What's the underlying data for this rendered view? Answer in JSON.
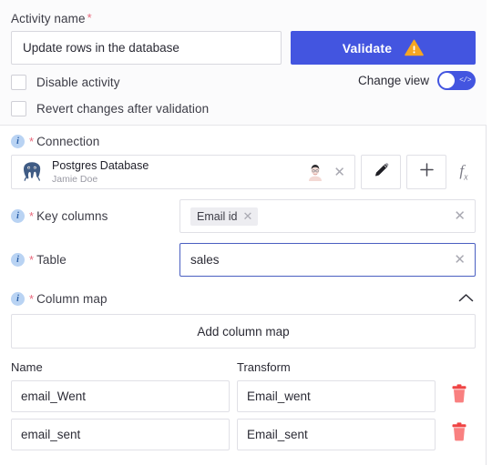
{
  "header": {
    "activity_name_label": "Activity name",
    "required_marker": "*",
    "activity_name_value": "Update rows in the database",
    "validate_label": "Validate",
    "validate_icon": "warning-triangle-icon",
    "validate_color": "#4355e0",
    "warning_color": "#f5a623",
    "change_view_label": "Change view",
    "toggle_icon": "code-icon",
    "toggle_glyph": "</>",
    "checkboxes": [
      {
        "label": "Disable activity",
        "checked": false
      },
      {
        "label": "Revert changes after validation",
        "checked": false
      }
    ]
  },
  "connection": {
    "label": "Connection",
    "info_icon": "info-icon",
    "required_marker": "*",
    "name": "Postgres Database",
    "owner": "Jamie Doe",
    "logo_icon": "postgres-elephant-icon",
    "avatar_icon": "user-avatar-icon",
    "clear_icon": "close-icon",
    "edit_icon": "pencil-icon",
    "add_icon": "plus-icon",
    "fx_icon": "fx-icon",
    "fx_glyph": "f",
    "fx_sub": "x"
  },
  "key_columns": {
    "label": "Key columns",
    "info_icon": "info-icon",
    "required_marker": "*",
    "chips": [
      {
        "label": "Email id",
        "remove_icon": "close-icon"
      }
    ],
    "clear_icon": "close-icon"
  },
  "table_field": {
    "label": "Table",
    "info_icon": "info-icon",
    "required_marker": "*",
    "value": "sales",
    "clear_icon": "close-icon",
    "focused": true,
    "focus_color": "#4a5fc1"
  },
  "column_map": {
    "label": "Column map",
    "info_icon": "info-icon",
    "required_marker": "*",
    "collapse_icon": "chevron-up-icon",
    "add_button_label": "Add column map",
    "columns": [
      "Name",
      "Transform"
    ],
    "rows": [
      {
        "name": "email_Went",
        "transform": "Email_went",
        "delete_icon": "trash-icon"
      },
      {
        "name": "email_sent",
        "transform": "Email_sent",
        "delete_icon": "trash-icon"
      }
    ],
    "delete_color": "#f87171"
  }
}
